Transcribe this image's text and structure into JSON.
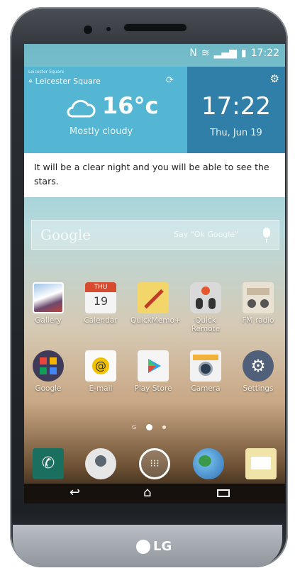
{
  "status_bar": {
    "time": "17:22"
  },
  "weather": {
    "location_small": "Leicester Square",
    "location": "Leicester Square",
    "temperature": "16°c",
    "condition": "Mostly cloudy"
  },
  "clock": {
    "time": "17:22",
    "date": "Thu, Jun 19"
  },
  "message": "It will be a clear night and you will be able to see the stars.",
  "search": {
    "brand": "Google",
    "hint": "Say \"Ok Google\""
  },
  "apps_row1": [
    {
      "label": "Gallery"
    },
    {
      "label": "Calendar",
      "month": "THU",
      "day": "19"
    },
    {
      "label": "QuickMemo+"
    },
    {
      "label": "Quick Remote"
    },
    {
      "label": "FM radio"
    }
  ],
  "apps_row2": [
    {
      "label": "Google"
    },
    {
      "label": "E-mail"
    },
    {
      "label": "Play Store"
    },
    {
      "label": "Camera"
    },
    {
      "label": "Settings"
    }
  ],
  "home_dots": {
    "google_page": "G"
  },
  "brand": {
    "logo_text": "LG"
  },
  "colors": {
    "weather_left": "#55b6d3",
    "weather_right": "#2f7fa8"
  }
}
